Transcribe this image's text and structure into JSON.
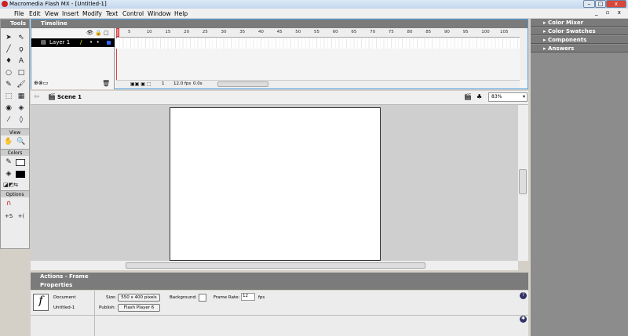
{
  "window": {
    "title": "Macromedia Flash MX - [Untitled-1]",
    "minimize": "–",
    "maximize": "□",
    "close": "x"
  },
  "menu": [
    "File",
    "Edit",
    "View",
    "Insert",
    "Modify",
    "Text",
    "Control",
    "Window",
    "Help"
  ],
  "tools": {
    "title": "Tools",
    "view_label": "View",
    "colors_label": "Colors",
    "options_label": "Options"
  },
  "timeline": {
    "title": "Timeline",
    "layer_name": "Layer 1",
    "frame_numbers": [
      5,
      10,
      15,
      20,
      25,
      30,
      35,
      40,
      45,
      50,
      55,
      60,
      65,
      70,
      75,
      80,
      85,
      90,
      95,
      100,
      105
    ],
    "current_frame": "1",
    "frame_rate": "12.0 fps",
    "elapsed": "0.0s"
  },
  "scene": {
    "name": "Scene 1",
    "zoom": "83%"
  },
  "right_panels": [
    "Color Mixer",
    "Color Swatches",
    "Components",
    "Answers"
  ],
  "actions": {
    "title": "Actions - Frame"
  },
  "properties": {
    "title": "Properties",
    "doc_type": "Document",
    "doc_name": "Untitled-1",
    "size_label": "Size:",
    "size_value": "550 x 400 pixels",
    "publish_label": "Publish:",
    "publish_value": "Flash Player 6",
    "background_label": "Background:",
    "frame_rate_label": "Frame Rate:",
    "frame_rate_value": "12",
    "fps_label": "fps"
  },
  "colors": {
    "accent": "#4a9ee0",
    "panel_header": "#7b7b7b",
    "playhead": "#e04040"
  }
}
